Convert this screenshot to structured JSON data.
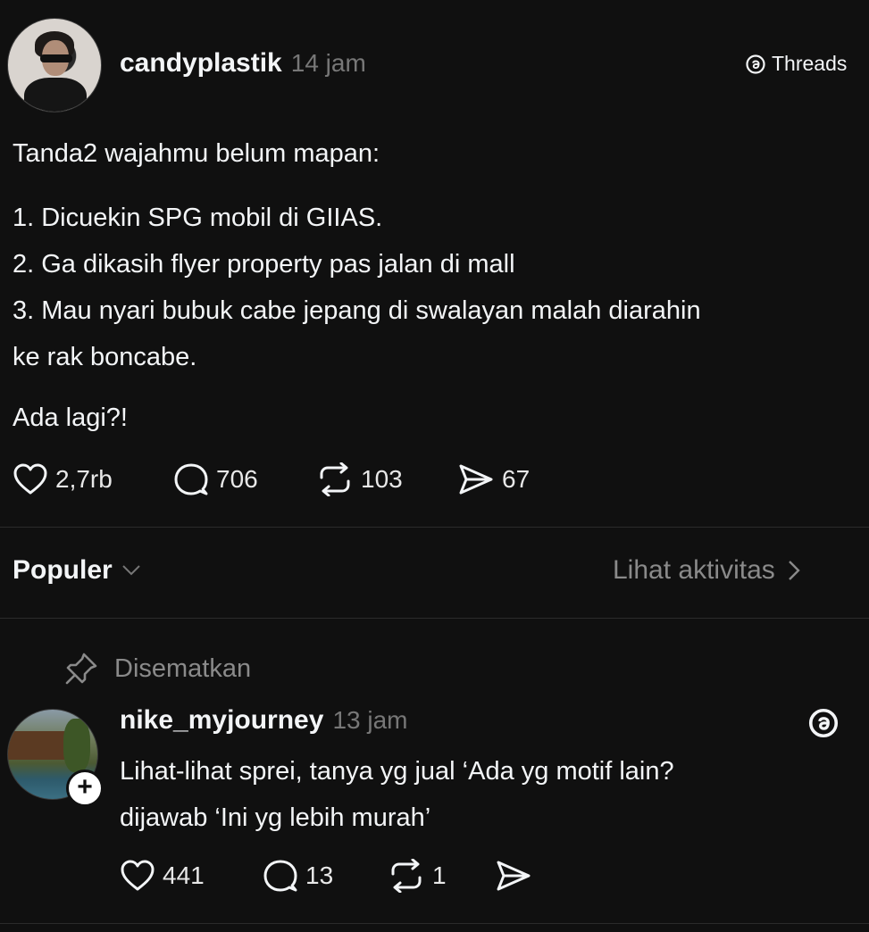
{
  "post": {
    "username": "candyplastik",
    "time": "14 jam",
    "platform_label": "Threads",
    "lines": [
      "Tanda2 wajahmu belum mapan:",
      "1. Dicuekin SPG mobil di GIIAS.",
      "2. Ga dikasih flyer property pas jalan di mall",
      "3. Mau nyari bubuk cabe jepang di swalayan malah diarahin",
      "ke rak boncabe.",
      "Ada lagi?!"
    ],
    "stats": {
      "likes": "2,7rb",
      "replies": "706",
      "reposts": "103",
      "shares": "67"
    }
  },
  "sort_bar": {
    "sort_label": "Populer",
    "activity_label": "Lihat aktivitas"
  },
  "reply": {
    "pinned_label": "Disematkan",
    "username": "nike_myjourney",
    "time": "13 jam",
    "lines": [
      "Lihat-lihat sprei, tanya yg jual ‘Ada yg motif lain?",
      "dijawab ‘Ini yg lebih murah’"
    ],
    "stats": {
      "likes": "441",
      "replies": "13",
      "reposts": "1"
    }
  }
}
